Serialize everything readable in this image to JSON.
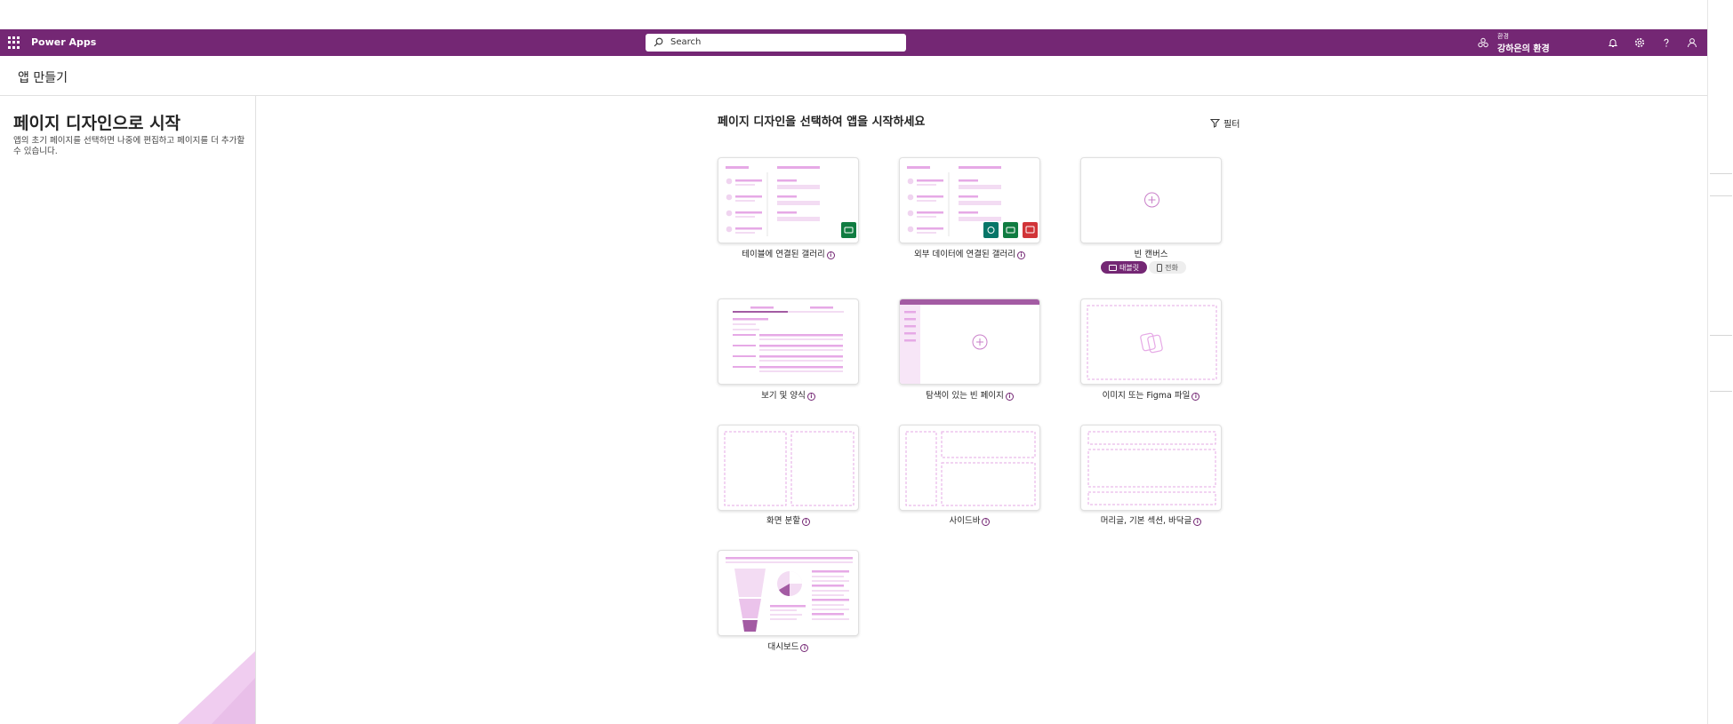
{
  "app": {
    "name": "Power Apps",
    "search_placeholder": "Search",
    "environment_label": "환경",
    "environment_name": "강하은의 환경"
  },
  "page": {
    "title": "앱 만들기"
  },
  "left_panel": {
    "heading": "페이지 디자인으로 시작",
    "description": "앱의 초기 페이지를 선택하면 나중에 편집하고 페이지를 더 추가할 수 있습니다."
  },
  "main": {
    "title": "페이지 디자인을 선택하여 앱을 시작하세요",
    "filter_label": "필터",
    "info_glyph": "i",
    "templates": [
      {
        "label": "테이블에 연결된 갤러리",
        "icon": "gallery-table-thumbnail"
      },
      {
        "label": "외부 데이터에 연결된 갤러리",
        "icon": "gallery-external-thumbnail"
      },
      {
        "label": "빈 캔버스",
        "icon": "blank-canvas-thumbnail"
      },
      {
        "label": "보기 및 양식",
        "icon": "view-form-thumbnail"
      },
      {
        "label": "탐색이 있는 빈 페이지",
        "icon": "blank-nav-thumbnail"
      },
      {
        "label": "이미지 또는 Figma 파일",
        "icon": "image-figma-thumbnail"
      },
      {
        "label": "화면 분할",
        "icon": "split-screen-thumbnail"
      },
      {
        "label": "사이드바",
        "icon": "sidebar-thumbnail"
      },
      {
        "label": "머리글, 기본 섹션, 바닥글",
        "icon": "header-footer-thumbnail"
      },
      {
        "label": "대시보드",
        "icon": "dashboard-thumbnail"
      }
    ],
    "format_options": {
      "tablet": "태블릿",
      "phone": "전화",
      "selected": "태블릿"
    }
  },
  "colors": {
    "header_bg": "#742774",
    "accent": "#742774",
    "thumb_light": "#f3dcf3",
    "thumb_mid": "#e6a9e6",
    "badge_green": "#107c41",
    "badge_teal": "#077568",
    "badge_red": "#d13438"
  }
}
